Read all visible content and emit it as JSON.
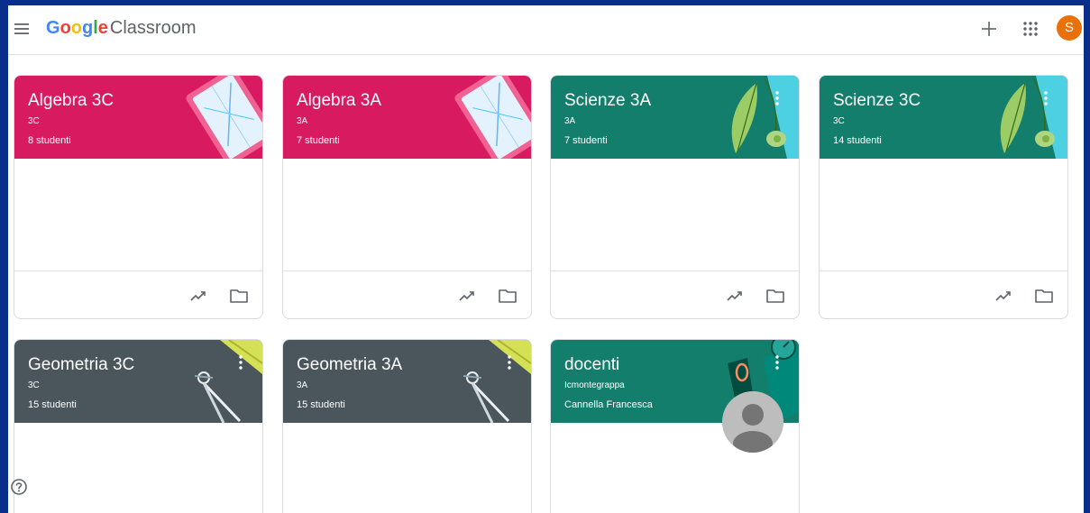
{
  "app": {
    "logo_text": "Google",
    "product_name": "Classroom",
    "logo_colors": [
      "#4285F4",
      "#EA4335",
      "#FBBC05",
      "#4285F4",
      "#34A853",
      "#EA4335"
    ]
  },
  "header": {
    "menu_icon": "hamburger-menu-icon",
    "create_icon": "plus-icon",
    "apps_icon": "apps-grid-icon",
    "avatar_initial": "S",
    "avatar_color": "#e8710a"
  },
  "classes": [
    {
      "name": "Algebra 3C",
      "section": "3C",
      "students": "8 studenti",
      "theme": "pink"
    },
    {
      "name": "Algebra 3A",
      "section": "3A",
      "students": "7 studenti",
      "theme": "pink"
    },
    {
      "name": "Scienze 3A",
      "section": "3A",
      "students": "7 studenti",
      "theme": "teal"
    },
    {
      "name": "Scienze 3C",
      "section": "3C",
      "students": "14 studenti",
      "theme": "teal"
    },
    {
      "name": "Geometria 3C",
      "section": "3C",
      "students": "15 studenti",
      "theme": "slate"
    },
    {
      "name": "Geometria 3A",
      "section": "3A",
      "students": "15 studenti",
      "theme": "slate"
    },
    {
      "name": "docenti",
      "section": "Icmontegrappa",
      "students": "Cannella Francesca",
      "theme": "teal"
    }
  ],
  "colors": {
    "pink": "#d81b60",
    "teal": "#137e6c",
    "slate": "#4a565c",
    "page_border": "#0a2e8c"
  },
  "footer_icons": [
    "trending-up-icon",
    "folder-icon"
  ],
  "help_icon": "help-icon"
}
